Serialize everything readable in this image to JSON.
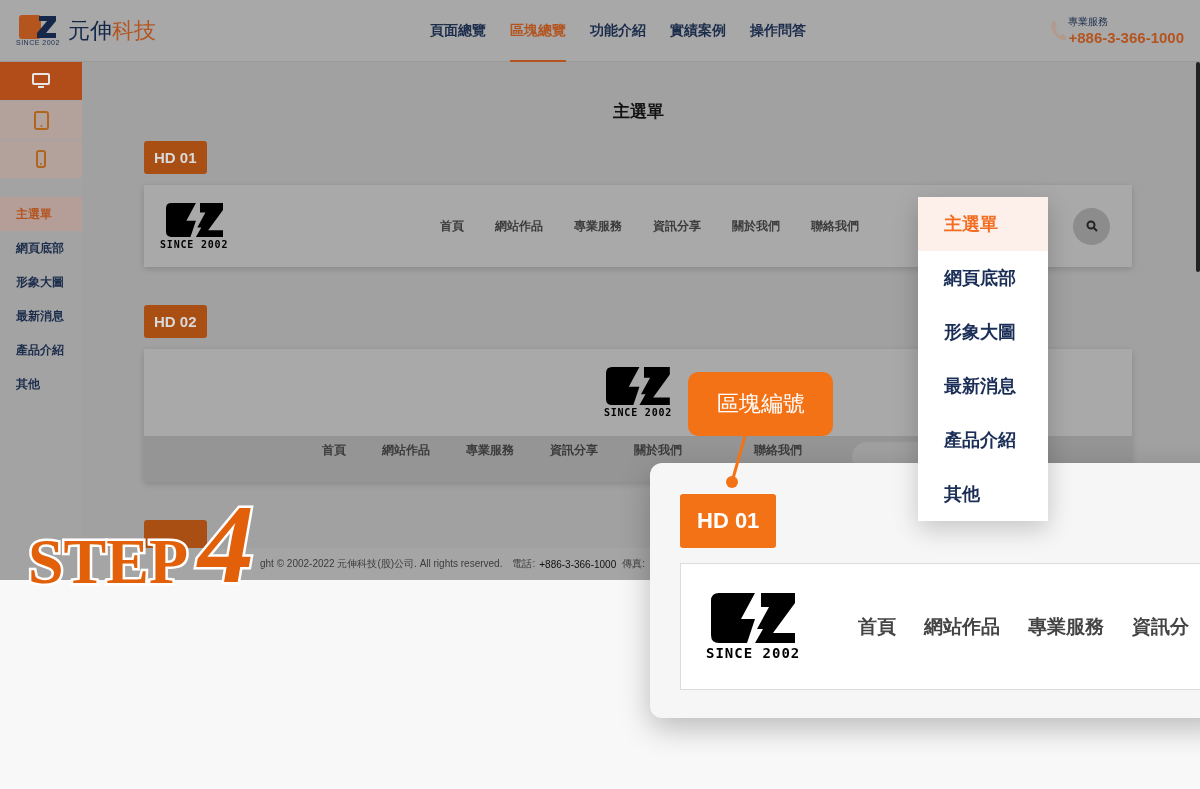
{
  "header": {
    "logo_text": "SINCE 2002",
    "brand_parts": [
      "元伸",
      "科技"
    ],
    "nav": [
      {
        "label": "頁面總覽",
        "selected": false
      },
      {
        "label": "區塊總覽",
        "selected": true
      },
      {
        "label": "功能介紹",
        "selected": false
      },
      {
        "label": "實績案例",
        "selected": false
      },
      {
        "label": "操作問答",
        "selected": false
      }
    ],
    "contact_label": "專業服務",
    "phone": "+886-3-366-1000"
  },
  "device_tabs": [
    {
      "kind": "desktop",
      "selected": true
    },
    {
      "kind": "tablet",
      "selected": false
    },
    {
      "kind": "mobile",
      "selected": false
    }
  ],
  "sidebar": {
    "items": [
      {
        "label": "主選單",
        "selected": true
      },
      {
        "label": "網頁底部",
        "selected": false
      },
      {
        "label": "形象大圖",
        "selected": false
      },
      {
        "label": "最新消息",
        "selected": false
      },
      {
        "label": "產品介紹",
        "selected": false
      },
      {
        "label": "其他",
        "selected": false
      }
    ]
  },
  "page_title": "主選單",
  "blocks": [
    {
      "badge": "HD 01",
      "kind": "inline",
      "logo_text": "SINCE 2002",
      "nav": [
        "首頁",
        "網站作品",
        "專業服務",
        "資訊分享",
        "關於我們",
        "聯絡我們"
      ]
    },
    {
      "badge": "HD 02",
      "kind": "stacked",
      "logo_text": "SINCE 2002",
      "nav": [
        "首頁",
        "網站作品",
        "專業服務",
        "資訊分享",
        "關於我們",
        "聯絡我們"
      ]
    },
    {
      "kind": "stub"
    }
  ],
  "footer": {
    "copyright": "ght © 2002-2022 元伸科技(股)公司. All rights reserved.",
    "phone_label": "電話:",
    "phone": "+886-3-366-1000",
    "fax": "傳真:"
  },
  "step": {
    "word": "STEP",
    "number": "4"
  },
  "callout": {
    "text": "區塊編號"
  },
  "dropdown": {
    "items": [
      {
        "label": "主選單",
        "selected": true
      },
      {
        "label": "網頁底部",
        "selected": false
      },
      {
        "label": "形象大圖",
        "selected": false
      },
      {
        "label": "最新消息",
        "selected": false
      },
      {
        "label": "產品介紹",
        "selected": false
      },
      {
        "label": "其他",
        "selected": false
      }
    ]
  },
  "zoom": {
    "badge": "HD 01",
    "logo_text": "SINCE 2002",
    "nav": [
      "首頁",
      "網站作品",
      "專業服務",
      "資訊分"
    ]
  }
}
